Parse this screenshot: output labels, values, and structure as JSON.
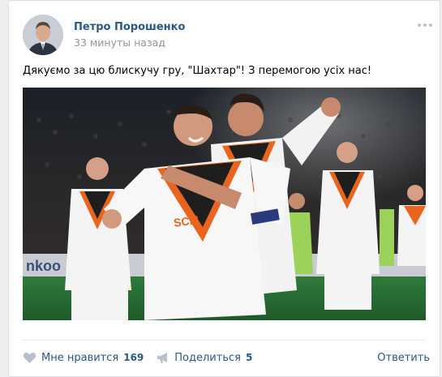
{
  "post": {
    "author": "Петро Порошенко",
    "time": "33 минуты назад",
    "text": "Дякуємо за цю блискучу гру, \"Шахтар\"! З перемогою усіх нас!"
  },
  "photo": {
    "sponsor_text": "SCM",
    "board_text": "nkoo"
  },
  "actions": {
    "like_label": "Мне нравится",
    "like_count": "169",
    "share_label": "Поделиться",
    "share_count": "5",
    "reply_label": "Ответить"
  },
  "colors": {
    "link": "#2a5885",
    "meta": "#939393",
    "icon": "#b6c1cd",
    "kit_orange": "#e8641f",
    "kit_white": "#ffffff"
  },
  "icons": {
    "like": "heart-icon",
    "share": "megaphone-icon",
    "more": "more-dots-icon"
  }
}
